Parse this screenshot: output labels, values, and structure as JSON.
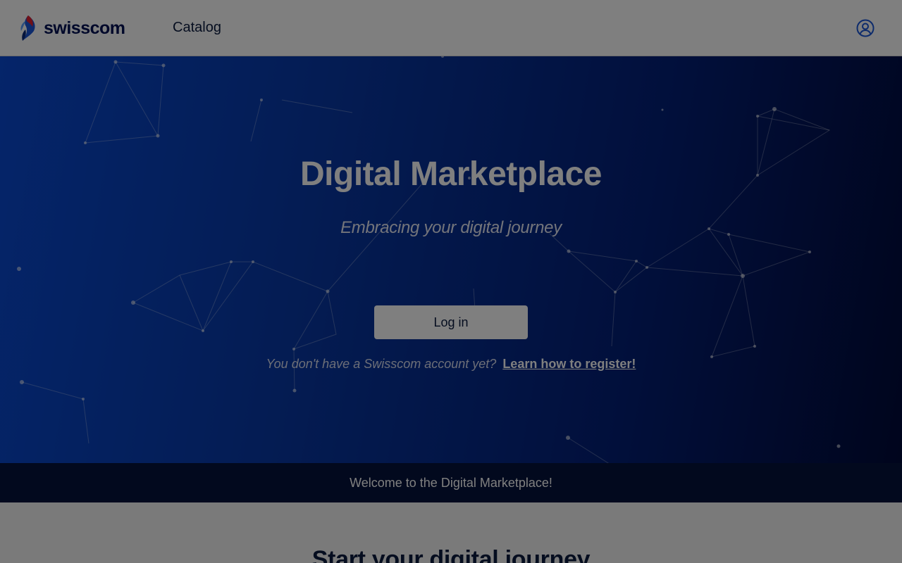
{
  "header": {
    "logo_text": "swisscom",
    "nav_catalog": "Catalog",
    "profile_icon": "user-circle-icon"
  },
  "hero": {
    "title": "Digital Marketplace",
    "subtitle": "Embracing your digital journey",
    "login_label": "Log in",
    "register_question": "You don't have a Swisscom account yet?",
    "register_link": "Learn how to register!"
  },
  "banner": {
    "text": "Welcome to the Digital Marketplace!"
  },
  "section": {
    "title": "Start your digital journey"
  },
  "colors": {
    "brand_navy": "#001155",
    "hero_blue": "#0838a6",
    "banner_dark": "#05133d",
    "overlay": "rgba(0,0,0,0.5)"
  }
}
